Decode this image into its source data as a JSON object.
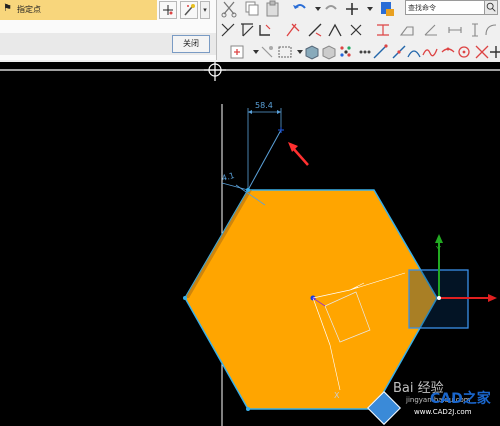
{
  "dialog": {
    "field_label": "指定点",
    "close_label": "关闭"
  },
  "toolbar": {
    "search_placeholder": "查找命令"
  },
  "dimensions": {
    "horizontal": "58.4",
    "vertical": "4.1"
  },
  "axes": {
    "y": "Y",
    "x_lower": "X"
  },
  "watermark": {
    "text": "Bai 经验",
    "site": "jingyan.baidu.com",
    "brand": "CAD之家",
    "domain": "www.CAD2J.com"
  },
  "colors": {
    "hexagon": "#ffa500",
    "edge": "#3ab0e8",
    "field_bg": "#f8d67c",
    "arrow_red": "#ff3030",
    "axis_green": "#22aa22",
    "axis_red": "#e02020"
  }
}
